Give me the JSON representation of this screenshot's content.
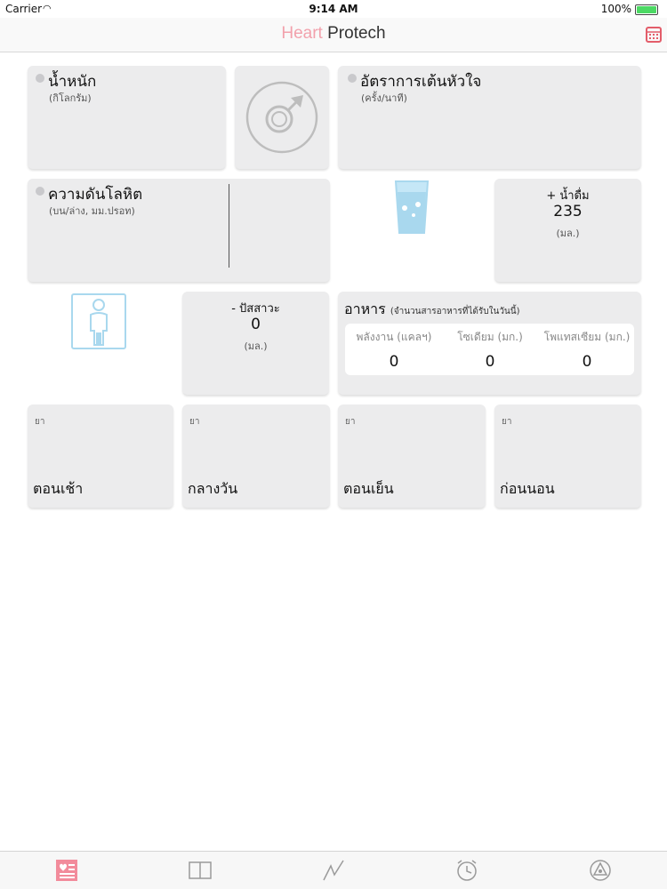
{
  "status": {
    "carrier": "Carrier",
    "time": "9:14 AM",
    "battery": "100%"
  },
  "header": {
    "title_part1": "Heart",
    "title_part2": "Protech"
  },
  "weight": {
    "title": "น้ำหนัก",
    "unit": "(กิโลกรัม)"
  },
  "heart_rate": {
    "title": "อัตราการเต้นหัวใจ",
    "unit": "(ครั้ง/นาที)"
  },
  "blood_pressure": {
    "title": "ความดันโลหิต",
    "unit": "(บน/ล่าง, มม.ปรอท)"
  },
  "water": {
    "label": "+ น้ำดื่ม",
    "value": "235",
    "unit": "(มล.)"
  },
  "urine": {
    "label": "- ปัสสาวะ",
    "value": "0",
    "unit": "(มล.)"
  },
  "food": {
    "title": "อาหาร",
    "subtitle": "(จำนวนสารอาหารที่ได้รับในวันนี้)",
    "cols": [
      {
        "label": "พลังงาน (แคลฯ)",
        "value": "0"
      },
      {
        "label": "โซเดียม (มก.)",
        "value": "0"
      },
      {
        "label": "โพแทสเซียม (มก.)",
        "value": "0"
      }
    ]
  },
  "medicine": [
    {
      "label": "ยา",
      "time": "ตอนเช้า"
    },
    {
      "label": "ยา",
      "time": "กลางวัน"
    },
    {
      "label": "ยา",
      "time": "ตอนเย็น"
    },
    {
      "label": "ยา",
      "time": "ก่อนนอน"
    }
  ],
  "tabs": [
    "dashboard-icon",
    "book-icon",
    "graph-icon",
    "alarm-icon",
    "settings-icon"
  ],
  "colors": {
    "accent": "#f2a1ac",
    "calendar": "#e35d6a",
    "card": "#ececed",
    "icon_blue": "#a9d8ee"
  }
}
